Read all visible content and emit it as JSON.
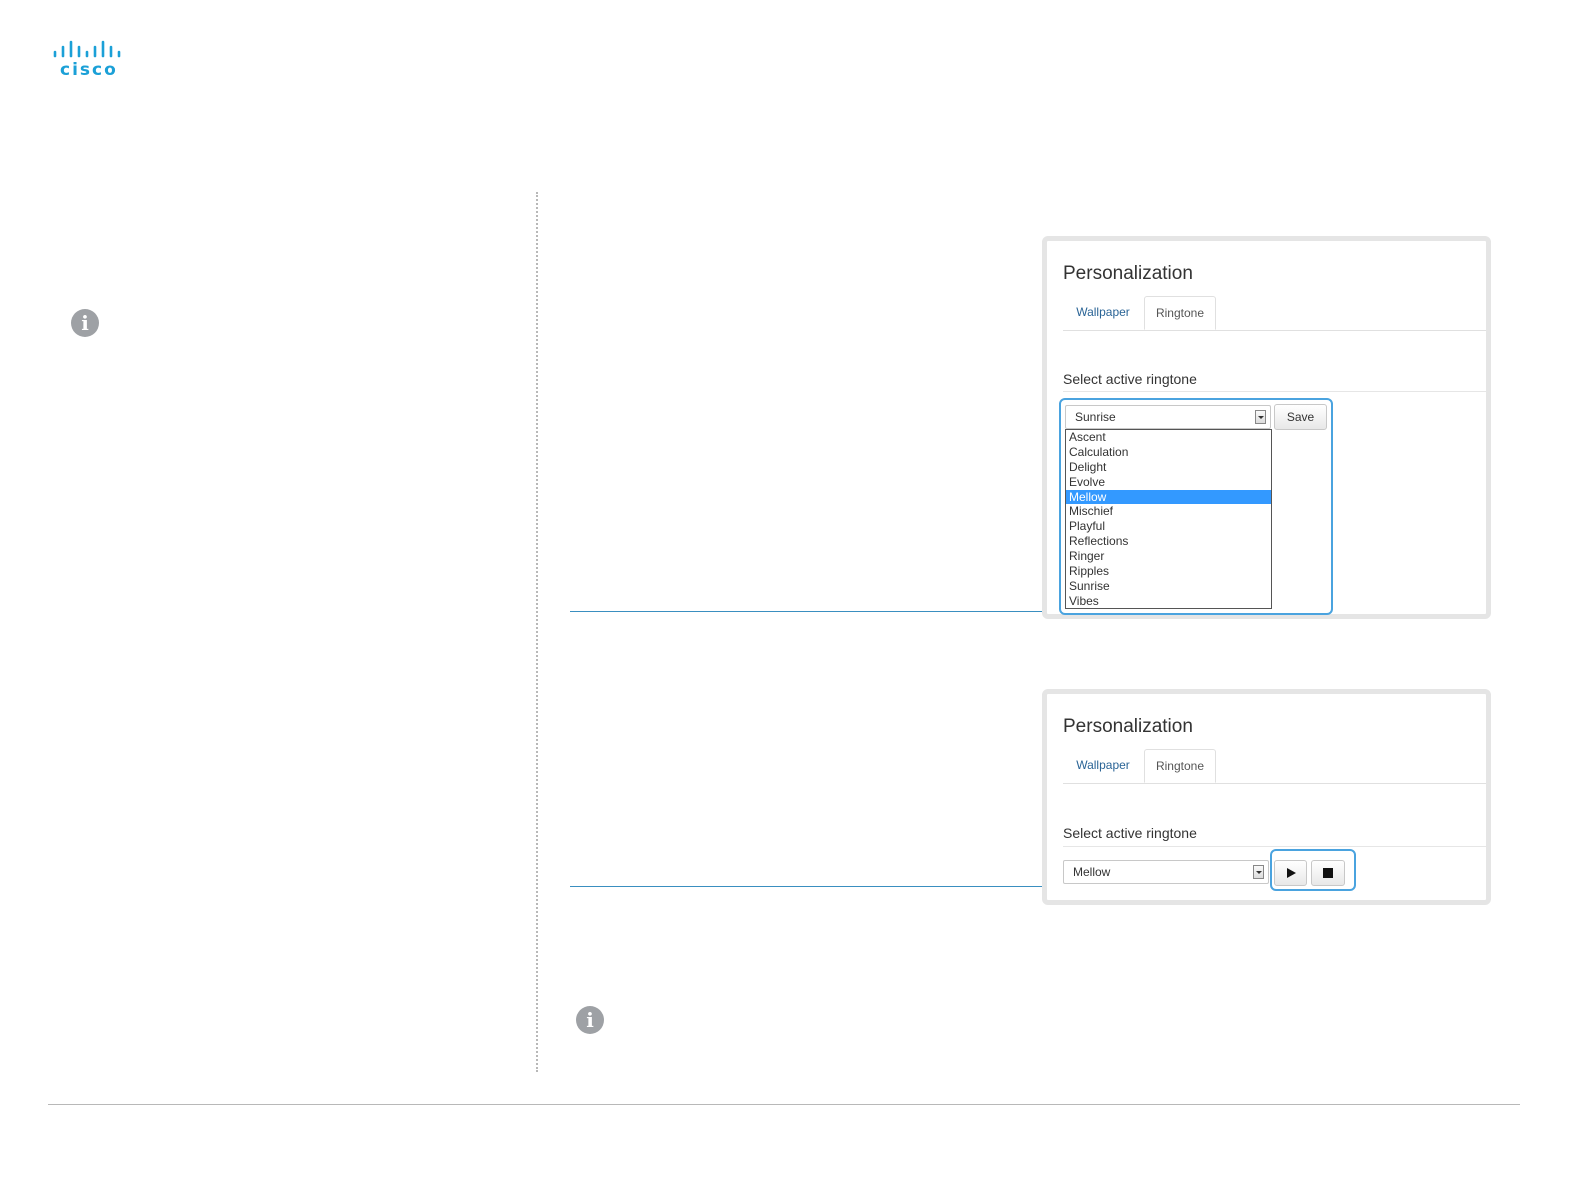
{
  "logo": {
    "text": "cisco"
  },
  "personalization_top": {
    "title": "Personalization",
    "tabs": [
      {
        "label": "Wallpaper",
        "active": false
      },
      {
        "label": "Ringtone",
        "active": true
      }
    ],
    "heading": "Select active ringtone",
    "select_value": "Sunrise",
    "save_label": "Save",
    "dropdown_options": [
      "Ascent",
      "Calculation",
      "Delight",
      "Evolve",
      "Mellow",
      "Mischief",
      "Playful",
      "Reflections",
      "Ringer",
      "Ripples",
      "Sunrise",
      "Vibes"
    ],
    "highlighted_option": "Mellow"
  },
  "personalization_bottom": {
    "title": "Personalization",
    "tabs": [
      {
        "label": "Wallpaper",
        "active": false
      },
      {
        "label": "Ringtone",
        "active": true
      }
    ],
    "heading": "Select active ringtone",
    "select_value": "Mellow",
    "play_icon": "play-icon",
    "stop_icon": "stop-icon"
  },
  "colors": {
    "brand": "#1ba0d7",
    "callout": "#4aa3df",
    "list_selection": "#3399ff"
  }
}
